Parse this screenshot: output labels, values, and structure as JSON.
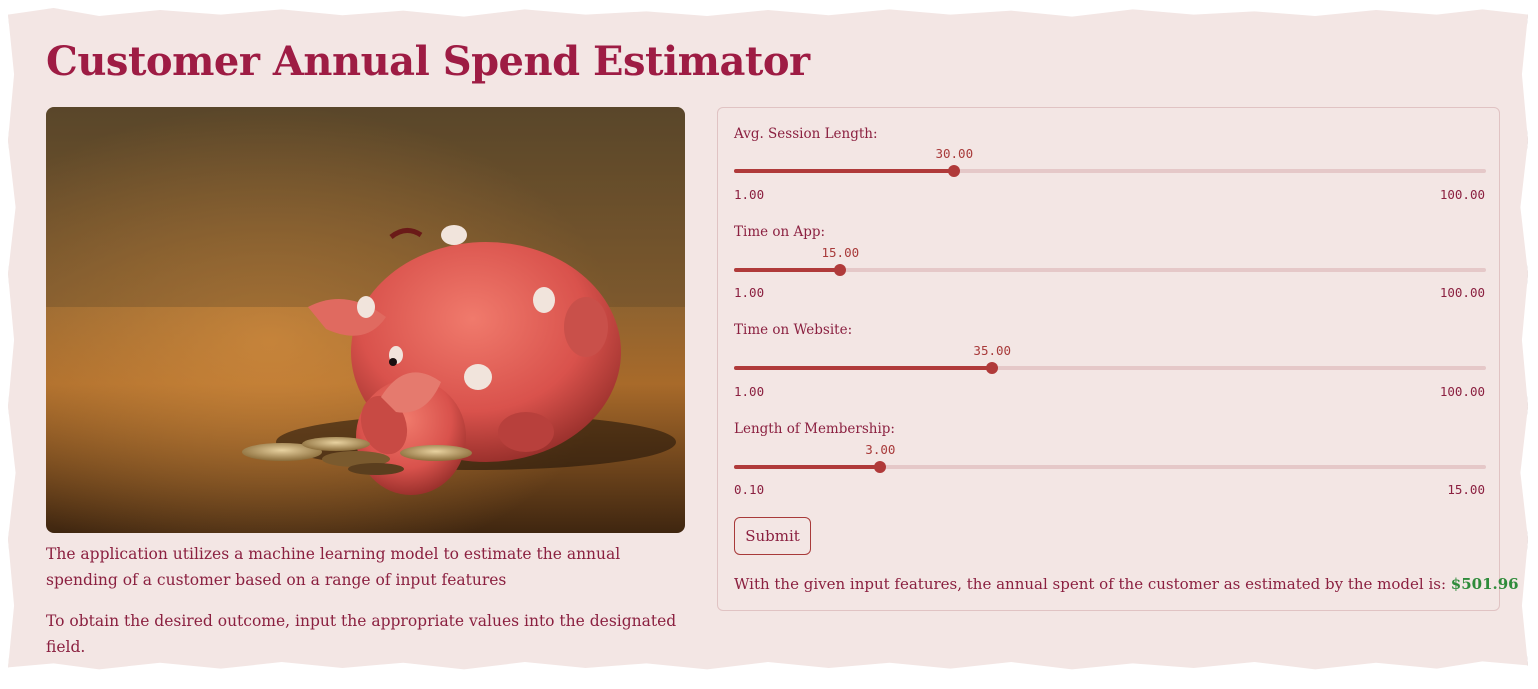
{
  "app": {
    "title": "Customer Annual Spend Estimator",
    "accent_color": "#9e1c44",
    "background_color": "#f3e6e4"
  },
  "hero_image": {
    "icon": "piggy-bank-photo",
    "alt": "Piggy bank with coins"
  },
  "description": {
    "paragraph1": "The application utilizes a machine learning model to estimate the annual spending of a customer based on a range of input features",
    "paragraph2": "To obtain the desired outcome, input the appropriate values into the designated field."
  },
  "sliders": [
    {
      "label": "Avg. Session Length:",
      "value": "30.00",
      "value_num": 30,
      "min": "1.00",
      "min_num": 1,
      "max": "100.00",
      "max_num": 100
    },
    {
      "label": "Time on App:",
      "value": "15.00",
      "value_num": 15,
      "min": "1.00",
      "min_num": 1,
      "max": "100.00",
      "max_num": 100
    },
    {
      "label": "Time on Website:",
      "value": "35.00",
      "value_num": 35,
      "min": "1.00",
      "min_num": 1,
      "max": "100.00",
      "max_num": 100
    },
    {
      "label": "Length of Membership:",
      "value": "3.00",
      "value_num": 3,
      "min": "0.10",
      "min_num": 0.1,
      "max": "15.00",
      "max_num": 15
    }
  ],
  "submit_label": "Submit",
  "result": {
    "text": "With the given input features, the annual spent of the customer as estimated by the model is: ",
    "value": "$501.96",
    "value_color": "#2e8b3a"
  }
}
